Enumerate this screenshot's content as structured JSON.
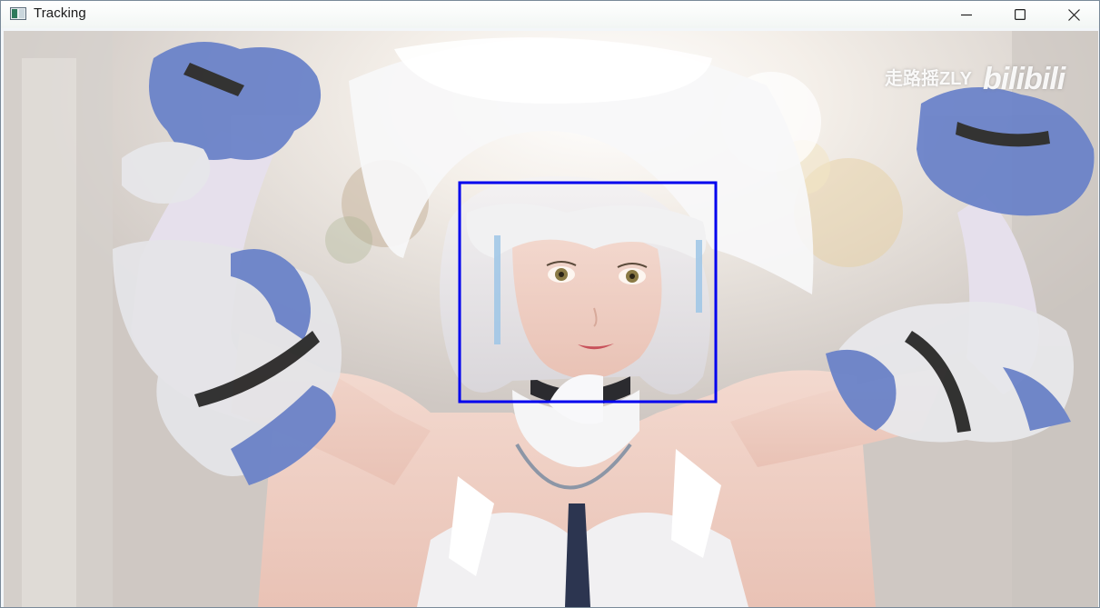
{
  "window": {
    "title": "Tracking",
    "app_icon": "opencv-window-icon",
    "controls": {
      "minimize_icon": "minimize-icon",
      "maximize_icon": "maximize-icon",
      "close_icon": "close-icon"
    }
  },
  "frame": {
    "watermark_user": "走路摇ZLY",
    "watermark_brand": "bilibili",
    "tracking_box_color": "#0000ee"
  },
  "colors": {
    "titlebar_bg": "#f2f6f4",
    "frame_bg": "#d8d3cf",
    "accent_blue": "#0000ee"
  }
}
